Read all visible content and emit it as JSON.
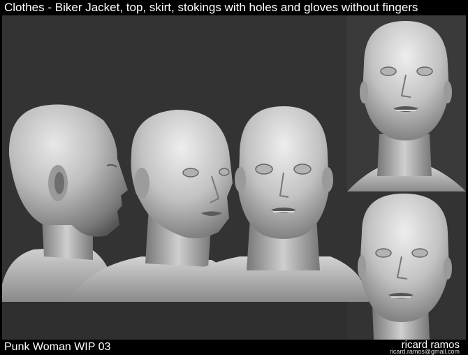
{
  "header": {
    "title": "Clothes - Biker Jacket, top, skirt, stokings with holes and gloves without fingers"
  },
  "footer": {
    "project_title": "Punk Woman WIP 03",
    "author_name": "ricard ramos",
    "author_email": "ricard.ramos@gmail.com"
  },
  "colors": {
    "background": "#333333",
    "frame": "#000000",
    "text": "#ffffff",
    "sculpt_light": "#dedede",
    "sculpt_dark": "#4a4a4a"
  }
}
